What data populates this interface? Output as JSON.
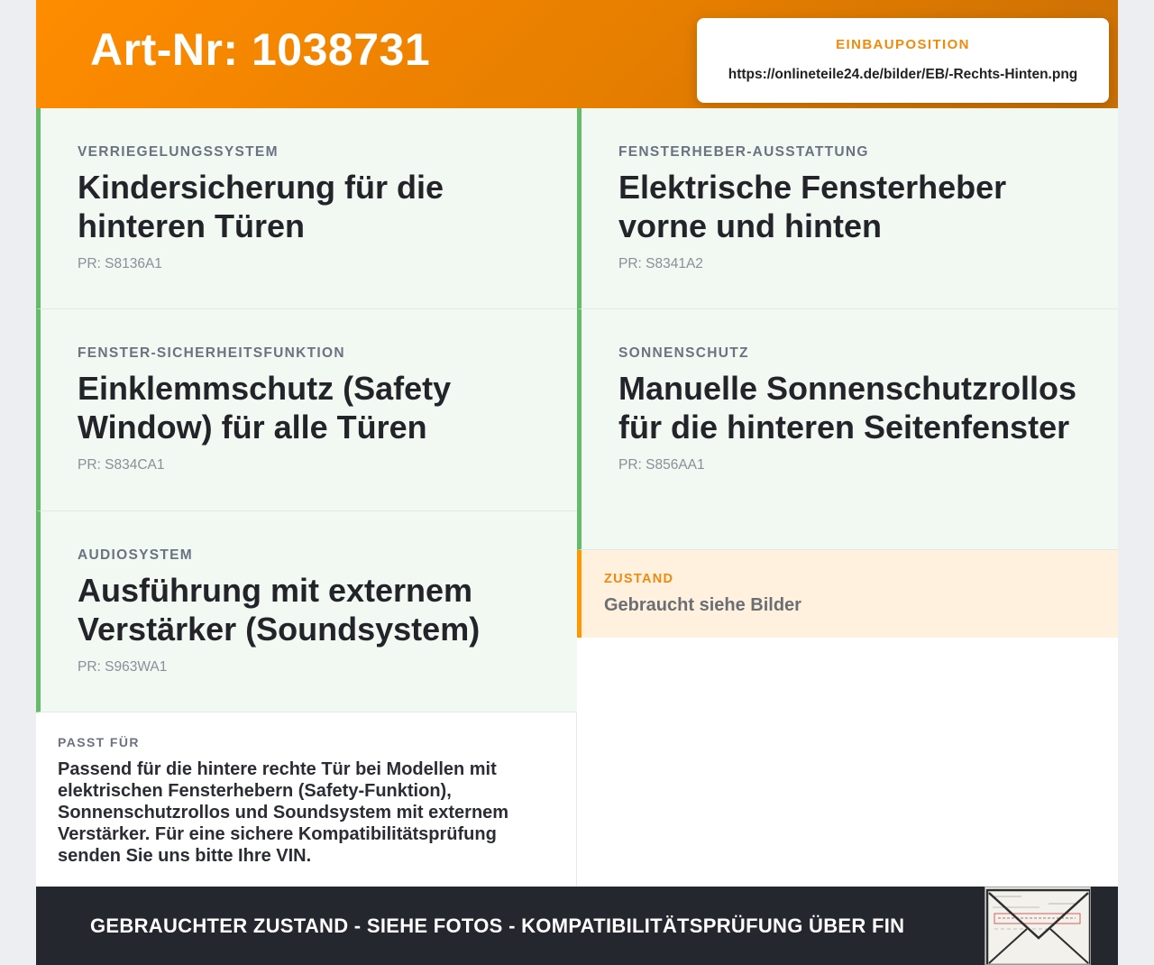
{
  "header": {
    "title": "Art-Nr: 1038731",
    "position_label": "EINBAUPOSITION",
    "position_url": "https://onlineteile24.de/bilder/EB/-Rechts-Hinten.png"
  },
  "features_left": [
    {
      "category": "VERRIEGELUNGSSYSTEM",
      "title": "Kindersicherung für die hinteren Türen",
      "pr": "PR: S8136A1"
    },
    {
      "category": "FENSTER-SICHERHEITSFUNKTION",
      "title": "Einklemmschutz (Safety Window) für alle Türen",
      "pr": "PR: S834CA1"
    },
    {
      "category": "AUDIOSYSTEM",
      "title": "Ausführung mit externem Verstärker (Soundsystem)",
      "pr": "PR: S963WA1"
    }
  ],
  "features_right": [
    {
      "category": "FENSTERHEBER-AUSSTATTUNG",
      "title": "Elektrische Fensterheber vorne und hinten",
      "pr": "PR: S8341A2"
    },
    {
      "category": "SONNENSCHUTZ",
      "title": "Manuelle Sonnenschutzrollos für die hinteren Seitenfenster",
      "pr": "PR: S856AA1"
    }
  ],
  "condition": {
    "label": "ZUSTAND",
    "value": "Gebraucht siehe Bilder"
  },
  "fits": {
    "label": "PASST FÜR",
    "text": "Passend für die hintere rechte Tür bei Modellen mit elektrischen Fensterhebern (Safety-Funktion), Sonnenschutzrollos und Soundsystem mit externem Verstärker. Für eine sichere Kompatibilitätsprüfung senden Sie uns bitte Ihre VIN."
  },
  "footer": {
    "text": "GEBRAUCHTER ZUSTAND - SIEHE FOTOS - KOMPATIBILITÄTSPRÜFUNG ÜBER FIN",
    "stamp_icon": "vehicle-document-envelope-icon"
  },
  "colors": {
    "brand_orange": "#ff8c00",
    "feature_accent": "#66bb6a",
    "condition_accent": "#ff9800",
    "footer_bg": "#24272d"
  }
}
